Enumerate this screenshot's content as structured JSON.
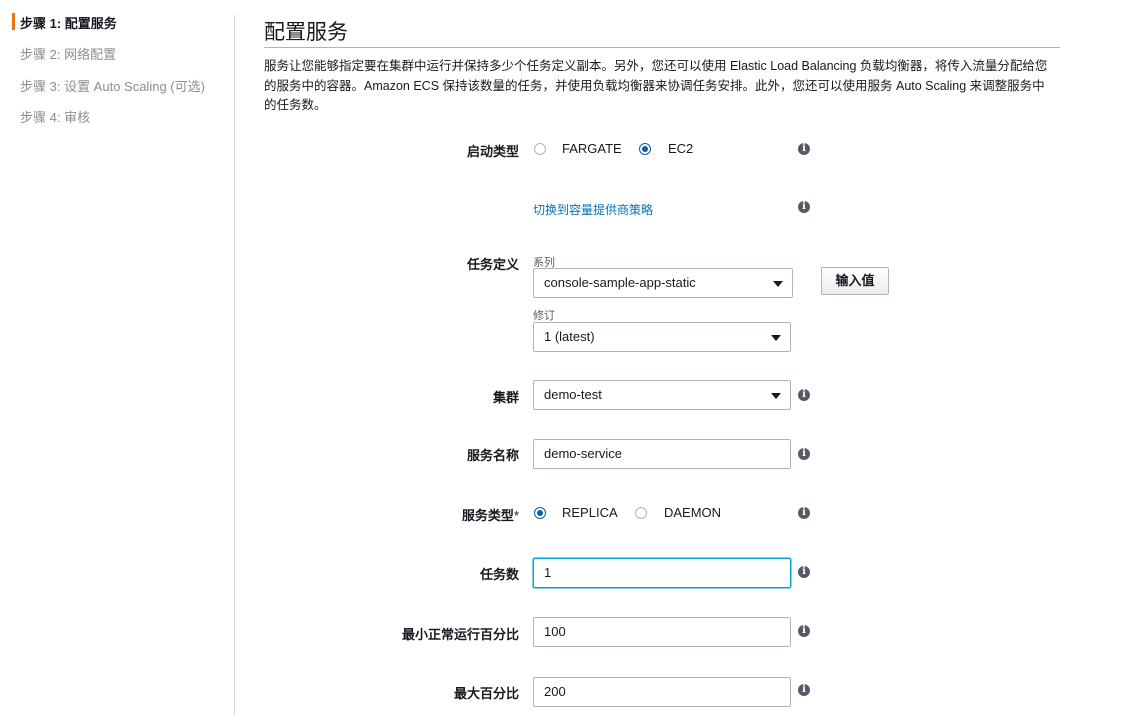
{
  "sidebar": {
    "steps": [
      {
        "label": "步骤 1: 配置服务"
      },
      {
        "label": "步骤 2: 网络配置"
      },
      {
        "label": "步骤 3: 设置 Auto Scaling (可选)"
      },
      {
        "label": "步骤 4: 审核"
      }
    ],
    "accent_color": "#ec7211"
  },
  "main": {
    "title": "配置服务",
    "description": "服务让您能够指定要在集群中运行并保持多少个任务定义副本。另外，您还可以使用 Elastic Load Balancing 负载均衡器，将传入流量分配给您的服务中的容器。Amazon ECS 保持该数量的任务，并使用负载均衡器来协调任务安排。此外，您还可以使用服务 Auto Scaling 来调整服务中的任务数。"
  },
  "form": {
    "launch_type": {
      "label": "启动类型",
      "options": [
        "FARGATE",
        "EC2"
      ],
      "selected": "EC2"
    },
    "capacity_link": "切换到容量提供商策略",
    "task_definition": {
      "label": "任务定义",
      "family_label": "系列",
      "family_value": "console-sample-app-static",
      "revision_label": "修订",
      "revision_value": "1 (latest)",
      "enter_value_button": "输入值"
    },
    "cluster": {
      "label": "集群",
      "value": "demo-test"
    },
    "service_name": {
      "label": "服务名称",
      "value": "demo-service"
    },
    "service_type": {
      "label": "服务类型",
      "required_mark": "*",
      "options": [
        "REPLICA",
        "DAEMON"
      ],
      "selected": "REPLICA"
    },
    "task_count": {
      "label": "任务数",
      "value": "1"
    },
    "min_healthy_percent": {
      "label": "最小正常运行百分比",
      "value": "100"
    },
    "max_percent": {
      "label": "最大百分比",
      "value": "200"
    }
  },
  "icons": {
    "info": "info-icon",
    "dropdown": "chevron-down-icon"
  },
  "colors": {
    "link": "#0073bb",
    "radio_checked": "#0a5ea8",
    "focus": "#00a1c9"
  }
}
